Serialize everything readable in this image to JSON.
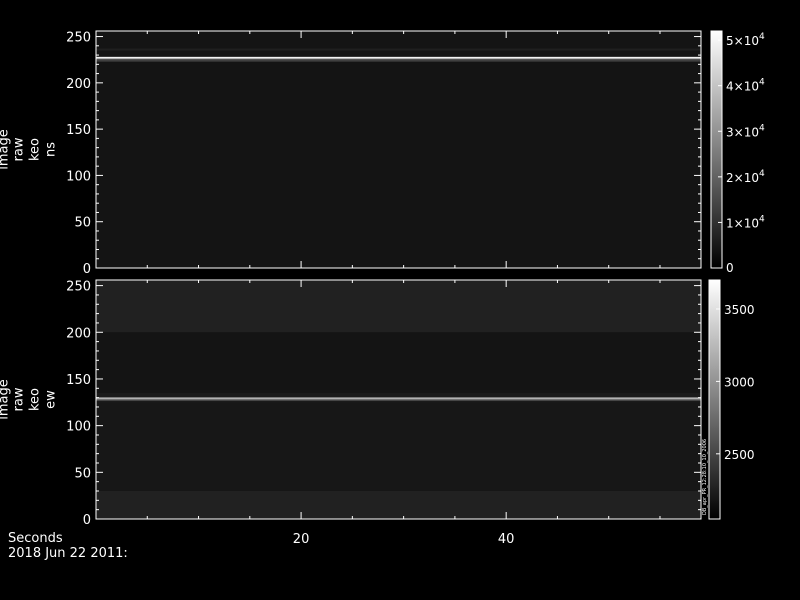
{
  "chart_data": [
    {
      "type": "heatmap",
      "name": "ns",
      "ylabel": [
        "image",
        "raw",
        "keo",
        "ns"
      ],
      "xlim": [
        0,
        59
      ],
      "ylim": [
        0,
        256
      ],
      "yticks": [
        0,
        50,
        100,
        150,
        200,
        250
      ],
      "xticks": [
        20,
        40
      ],
      "colorbar": {
        "range": [
          0,
          52000
        ],
        "ticks": [
          {
            "value": 0,
            "mantissa": "0",
            "exponent": ""
          },
          {
            "value": 10000,
            "mantissa": "1×10",
            "exponent": "4"
          },
          {
            "value": 20000,
            "mantissa": "2×10",
            "exponent": "4"
          },
          {
            "value": 30000,
            "mantissa": "3×10",
            "exponent": "4"
          },
          {
            "value": 40000,
            "mantissa": "4×10",
            "exponent": "4"
          },
          {
            "value": 50000,
            "mantissa": "5×10",
            "exponent": "4"
          }
        ]
      },
      "bright_rows": [
        {
          "y": 227,
          "level": 0.95
        },
        {
          "y": 225,
          "level": 0.35
        },
        {
          "y": 224,
          "level": 0.25
        },
        {
          "y": 236,
          "level": 0.12
        }
      ],
      "background_level": 0.08
    },
    {
      "type": "heatmap",
      "name": "ew",
      "ylabel": [
        "image",
        "raw",
        "keo",
        "ew"
      ],
      "xlim": [
        0,
        59
      ],
      "ylim": [
        0,
        256
      ],
      "yticks": [
        0,
        50,
        100,
        150,
        200,
        250
      ],
      "xticks": [
        20,
        40
      ],
      "colorbar": {
        "range": [
          2050,
          3700
        ],
        "ticks": [
          {
            "value": 2500,
            "mantissa": "2500",
            "exponent": ""
          },
          {
            "value": 3000,
            "mantissa": "3000",
            "exponent": ""
          },
          {
            "value": 3500,
            "mantissa": "3500",
            "exponent": ""
          }
        ],
        "side_note": "DB_apr_PR_12:28:10_10_2006"
      },
      "bright_rows": [
        {
          "y": 129,
          "level": 0.95
        },
        {
          "y": 128,
          "level": 0.45
        }
      ],
      "background_level": 0.1
    }
  ],
  "footer": {
    "xlabel": "Seconds",
    "date": "2018 Jun 22 2011:"
  }
}
